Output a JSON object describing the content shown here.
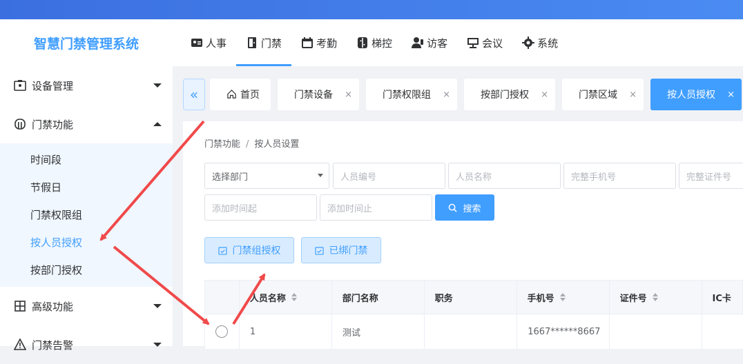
{
  "app": {
    "title": "智慧门禁管理系统"
  },
  "nav": [
    "人事",
    "门禁",
    "考勤",
    "梯控",
    "访客",
    "会议",
    "系统"
  ],
  "sidebar": {
    "menus": [
      {
        "label": "设备管理",
        "icon": "device-icon"
      },
      {
        "label": "门禁功能",
        "icon": "door-icon"
      },
      {
        "label": "高级功能",
        "icon": "grid-icon"
      },
      {
        "label": "门禁告警",
        "icon": "alarm-icon"
      }
    ],
    "sub": [
      "时间段",
      "节假日",
      "门禁权限组",
      "按人员授权",
      "按部门授权"
    ]
  },
  "tabs": [
    "首页",
    "门禁设备",
    "门禁权限组",
    "按部门授权",
    "门禁区域",
    "按人员授权"
  ],
  "tab_close": "×",
  "breadcrumb": {
    "first": "门禁功能",
    "sep": "/",
    "second": "按人员设置"
  },
  "filters": {
    "dept": "选择部门",
    "emp_no": "人员编号",
    "emp_name": "人员名称",
    "phone": "完整手机号",
    "cert": "完整证件号",
    "date_from": "添加时间起",
    "date_to": "添加时间止",
    "search": "搜索"
  },
  "actions": {
    "group_auth": "门禁组授权",
    "bound": "已绑门禁"
  },
  "table": {
    "headers": [
      "人员名称",
      "部门名称",
      "职务",
      "手机号",
      "证件号",
      "IC卡"
    ],
    "rows": [
      {
        "name": "1",
        "dept": "测试",
        "title": "",
        "phone": "1667******8667",
        "cert": "",
        "ic": ""
      }
    ]
  },
  "colors": {
    "accent": "#409eff",
    "annotation": "#f0494a"
  }
}
